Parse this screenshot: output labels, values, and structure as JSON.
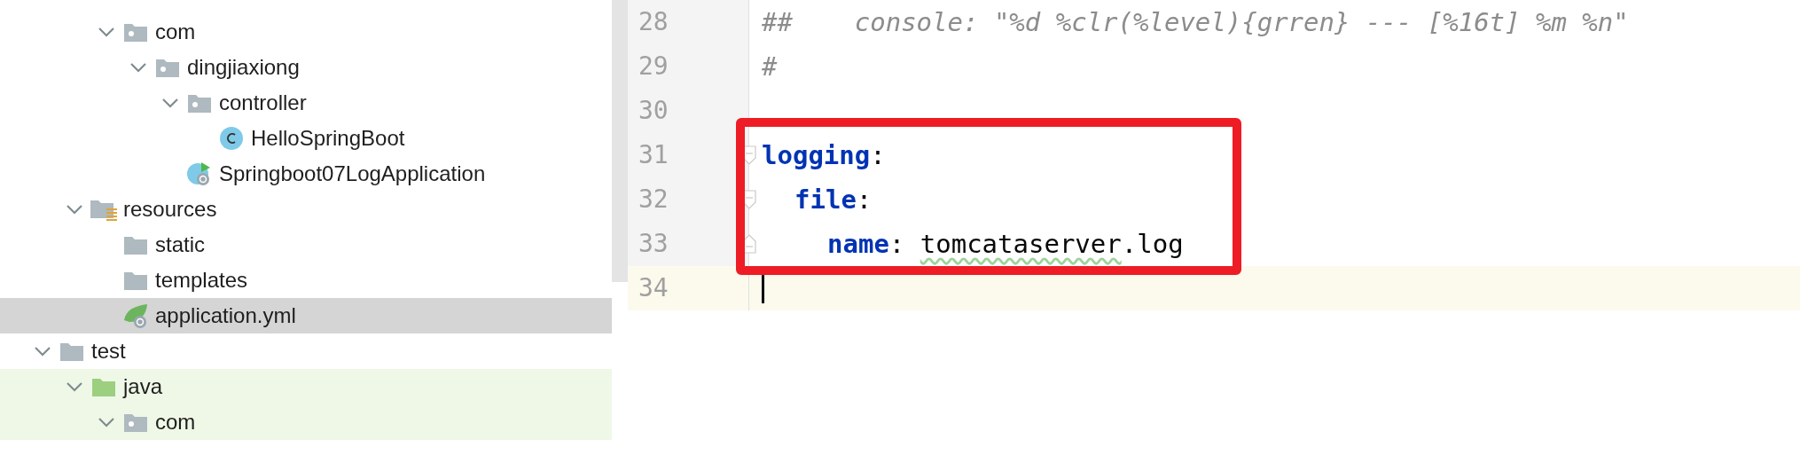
{
  "tree": {
    "items": [
      {
        "children": [
          {
            "children": [
              {
                "label": "com",
                "kind": "package",
                "expanded": true,
                "selected": false,
                "children": [
                  {
                    "label": "dingjiaxiong",
                    "kind": "package",
                    "expanded": true,
                    "selected": false,
                    "children": [
                      {
                        "label": "controller",
                        "kind": "package",
                        "expanded": true,
                        "selected": false,
                        "children": [
                          {
                            "label": "HelloSpringBoot",
                            "kind": "class",
                            "selected": false
                          }
                        ]
                      },
                      {
                        "label": "Springboot07LogApplication",
                        "kind": "spring-app",
                        "selected": false
                      }
                    ]
                  }
                ]
              }
            ]
          },
          {
            "label": "resources",
            "kind": "resources-folder",
            "expanded": true,
            "selected": false,
            "children": [
              {
                "label": "static",
                "kind": "folder",
                "selected": false
              },
              {
                "label": "templates",
                "kind": "folder",
                "selected": false
              },
              {
                "label": "application.yml",
                "kind": "yaml",
                "selected": true
              }
            ]
          }
        ]
      },
      {
        "label": "test",
        "kind": "folder",
        "expanded": true,
        "selected": false,
        "children": [
          {
            "label": "java",
            "kind": "test-folder",
            "expanded": true,
            "selected": false,
            "children": [
              {
                "label": "com",
                "kind": "package",
                "expanded": true,
                "selected": false
              }
            ]
          }
        ]
      }
    ]
  },
  "editor": {
    "lines": [
      {
        "number": "28",
        "current": false,
        "tokens": [
          {
            "text": "##    console: \"%d %clr(%level){grren} --- [%16t] %m %n\"",
            "kind": "comment"
          }
        ]
      },
      {
        "number": "29",
        "current": false,
        "tokens": [
          {
            "text": "#",
            "kind": "comment"
          }
        ]
      },
      {
        "number": "30",
        "current": false
      },
      {
        "number": "31",
        "current": false,
        "fold_start": true,
        "tokens": [
          {
            "text": "logging",
            "kind": "key"
          },
          {
            "text": ":",
            "kind": "punct"
          }
        ],
        "children": [
          {
            "number": "32",
            "current": false,
            "fold_start": true,
            "tokens": [
              {
                "text": "file",
                "kind": "key"
              },
              {
                "text": ":",
                "kind": "punct"
              }
            ],
            "children": [
              {
                "number": "33",
                "current": false,
                "fold_end": true,
                "tokens": [
                  {
                    "text": "name",
                    "kind": "key"
                  },
                  {
                    "text": ": ",
                    "kind": "punct"
                  },
                  {
                    "text": "tomcataserver",
                    "kind": "typo"
                  },
                  {
                    "text": ".log",
                    "kind": "value"
                  }
                ]
              }
            ]
          }
        ]
      },
      {
        "number": "34",
        "current": true
      }
    ]
  },
  "annotation": {
    "kind": "rectangle"
  }
}
